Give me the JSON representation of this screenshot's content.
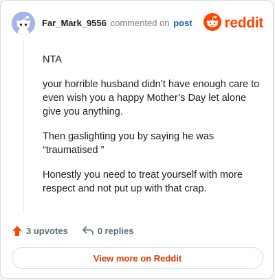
{
  "header": {
    "username": "Far_Mark_9556",
    "action_text": "commented on",
    "post_link": "post",
    "brand": "reddit",
    "avatar_icon": "snoo-avatar-icon",
    "brand_icon": "reddit-logo-icon"
  },
  "comment": {
    "paragraphs": [
      "NTA",
      "your horrible husband didn’t have enough care to even wish you a happy Mother’s Day let alone give you anything.",
      "Then gaslighting you by saying he was “traumatised ”",
      "Honestly you need to treat yourself with more respect and not put up with that crap."
    ]
  },
  "footer": {
    "upvotes": "3 upvotes",
    "replies": "0 replies",
    "upvote_icon": "upvote-arrow-icon",
    "reply_icon": "reply-arrow-icon"
  },
  "view_more_label": "View more on Reddit",
  "colors": {
    "brand": "#ff4500",
    "link": "#1a5fb4",
    "view_more": "#d93900",
    "muted": "#576f76"
  }
}
